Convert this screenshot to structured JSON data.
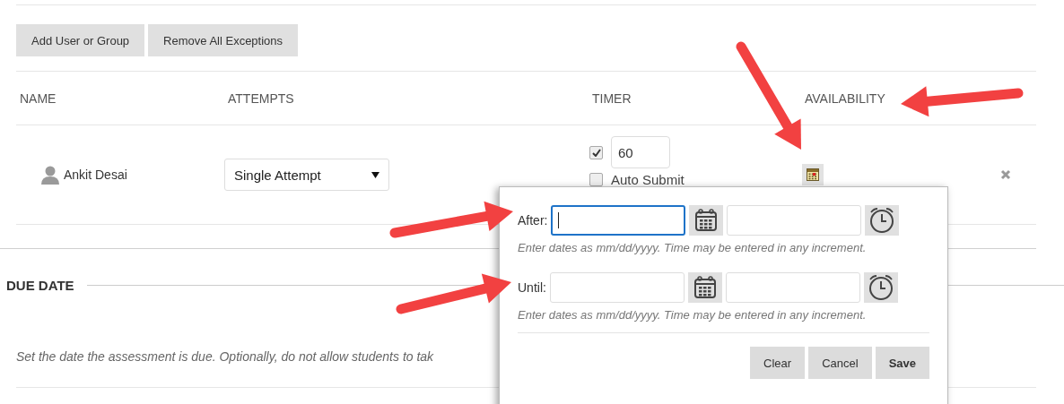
{
  "toolbar": {
    "buttons": [
      "Add User or Group",
      "Remove All Exceptions"
    ]
  },
  "table": {
    "columns": [
      "NAME",
      "ATTEMPTS",
      "TIMER",
      "AVAILABILITY"
    ],
    "rows": [
      {
        "name": "Ankit Desai",
        "attempts": "Single Attempt",
        "timer_enabled": true,
        "timer_minutes": "60",
        "auto_submit_label": "Auto Submit",
        "auto_submit": false
      }
    ]
  },
  "due_date": {
    "heading": "DUE DATE",
    "description": "Set the date the assessment is due. Optionally, do not allow students to tak"
  },
  "availability_popup": {
    "rows": [
      {
        "label": "After:",
        "focused": true,
        "hint": "Enter dates as mm/dd/yyyy. Time may be entered in any increment."
      },
      {
        "label": "Until:",
        "focused": false,
        "hint": "Enter dates as mm/dd/yyyy. Time may be entered in any increment."
      }
    ],
    "buttons": [
      {
        "label": "Clear",
        "primary": false
      },
      {
        "label": "Cancel",
        "primary": false
      },
      {
        "label": "Save",
        "primary": true
      }
    ]
  }
}
